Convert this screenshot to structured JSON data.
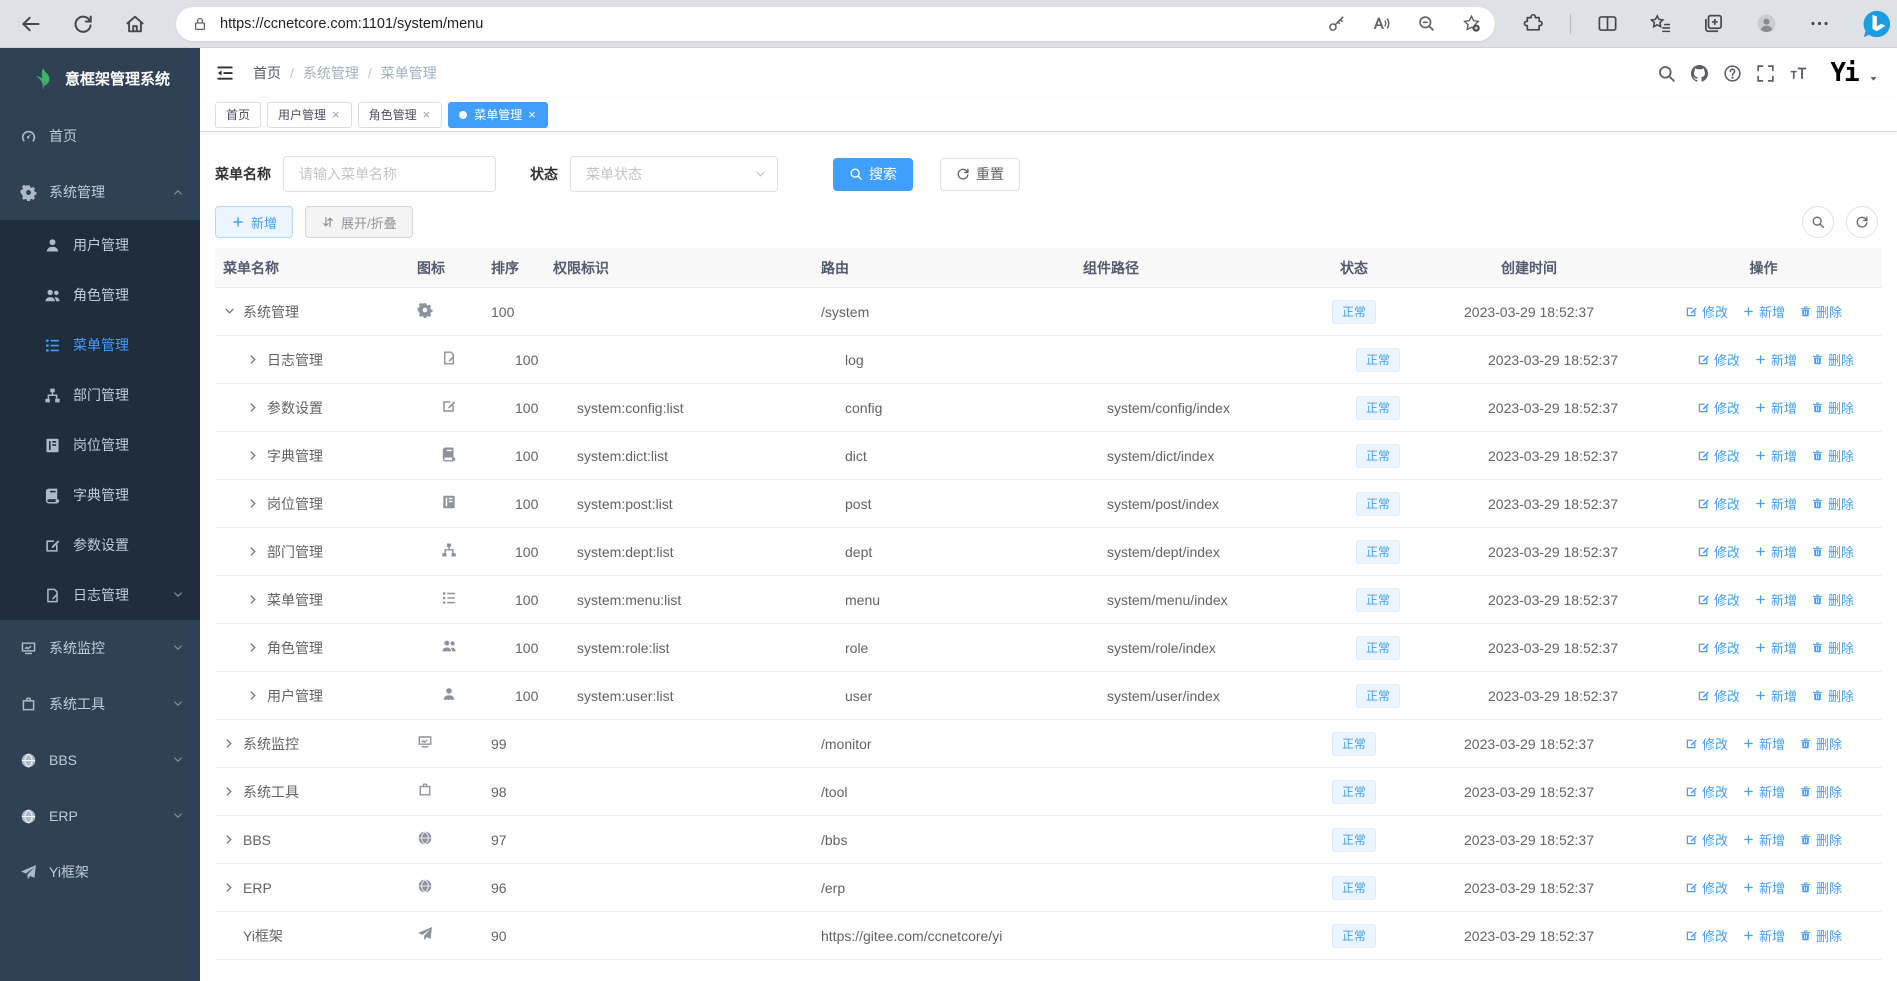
{
  "browser": {
    "url": "https://ccnetcore.com:1101/system/menu",
    "nav_icons": [
      "back-icon",
      "refresh-icon",
      "home-icon"
    ],
    "address_left_icon": "lock-icon",
    "address_right_icons": [
      "key-icon",
      "read-aloud-icon",
      "zoom-out-icon",
      "favorite-add-icon"
    ],
    "toolbar_icons": [
      "extensions-icon",
      "split-screen-icon",
      "favorites-bar-icon",
      "collections-icon",
      "profile-icon",
      "more-icon"
    ],
    "bing_icon": "bing-icon"
  },
  "sidebar": {
    "title": "意框架管理系统",
    "logo_icon": "leaf-icon",
    "items": [
      {
        "key": "home",
        "label": "首页",
        "icon": "dashboard-icon"
      },
      {
        "key": "system",
        "label": "系统管理",
        "icon": "gear-icon",
        "expanded": true,
        "children": [
          {
            "key": "user",
            "label": "用户管理",
            "icon": "user-icon"
          },
          {
            "key": "role",
            "label": "角色管理",
            "icon": "peoples-icon"
          },
          {
            "key": "menu",
            "label": "菜单管理",
            "icon": "menu-tree-icon",
            "active": true
          },
          {
            "key": "dept",
            "label": "部门管理",
            "icon": "dept-tree-icon"
          },
          {
            "key": "post",
            "label": "岗位管理",
            "icon": "post-icon"
          },
          {
            "key": "dict",
            "label": "字典管理",
            "icon": "dict-icon"
          },
          {
            "key": "config",
            "label": "参数设置",
            "icon": "edit-icon"
          },
          {
            "key": "log",
            "label": "日志管理",
            "icon": "log-icon",
            "collapsible": true
          }
        ]
      },
      {
        "key": "monitor",
        "label": "系统监控",
        "icon": "monitor-icon",
        "collapsible": true
      },
      {
        "key": "tool",
        "label": "系统工具",
        "icon": "tool-icon",
        "collapsible": true
      },
      {
        "key": "bbs",
        "label": "BBS",
        "icon": "globe-icon",
        "collapsible": true
      },
      {
        "key": "erp",
        "label": "ERP",
        "icon": "globe-icon",
        "collapsible": true
      },
      {
        "key": "yi",
        "label": "Yi框架",
        "icon": "plane-icon"
      }
    ]
  },
  "header": {
    "fold_icon": "fold-icon",
    "breadcrumb": [
      "首页",
      "系统管理",
      "菜单管理"
    ],
    "icons": [
      "search-icon",
      "github-icon",
      "question-icon",
      "fullscreen-icon",
      "font-size-icon"
    ],
    "logo_text": "Yi",
    "caret_icon": "caret-down-icon"
  },
  "tabs": [
    {
      "key": "home",
      "label": "首页",
      "closable": false,
      "active": false
    },
    {
      "key": "user",
      "label": "用户管理",
      "closable": true,
      "active": false
    },
    {
      "key": "role",
      "label": "角色管理",
      "closable": true,
      "active": false
    },
    {
      "key": "menu",
      "label": "菜单管理",
      "closable": true,
      "active": true
    }
  ],
  "filters": {
    "name_label": "菜单名称",
    "name_placeholder": "请输入菜单名称",
    "name_value": "",
    "status_label": "状态",
    "status_placeholder": "菜单状态",
    "search_label": "搜索",
    "reset_label": "重置"
  },
  "toolbar": {
    "add_label": "新增",
    "expand_label": "展开/折叠",
    "icon_buttons": [
      "search-icon",
      "refresh-icon"
    ]
  },
  "table": {
    "columns": [
      {
        "key": "name",
        "label": "菜单名称"
      },
      {
        "key": "icon",
        "label": "图标"
      },
      {
        "key": "sort",
        "label": "排序"
      },
      {
        "key": "perm",
        "label": "权限标识"
      },
      {
        "key": "route",
        "label": "路由"
      },
      {
        "key": "comp",
        "label": "组件路径"
      },
      {
        "key": "status",
        "label": "状态"
      },
      {
        "key": "time",
        "label": "创建时间"
      },
      {
        "key": "ops",
        "label": "操作"
      }
    ],
    "op_actions": [
      {
        "label": "修改",
        "icon": "edit-icon"
      },
      {
        "label": "新增",
        "icon": "plus-icon"
      },
      {
        "label": "删除",
        "icon": "delete-icon"
      }
    ],
    "rows": [
      {
        "name": "系统管理",
        "icon": "gear-icon",
        "expand": "open",
        "level": 0,
        "sort": "100",
        "perm": "",
        "route": "/system",
        "comp": "",
        "status": "正常",
        "time": "2023-03-29 18:52:37"
      },
      {
        "name": "日志管理",
        "icon": "log-icon",
        "expand": "closed",
        "level": 1,
        "sort": "100",
        "perm": "",
        "route": "log",
        "comp": "",
        "status": "正常",
        "time": "2023-03-29 18:52:37"
      },
      {
        "name": "参数设置",
        "icon": "edit-icon",
        "expand": "closed",
        "level": 1,
        "sort": "100",
        "perm": "system:config:list",
        "route": "config",
        "comp": "system/config/index",
        "status": "正常",
        "time": "2023-03-29 18:52:37"
      },
      {
        "name": "字典管理",
        "icon": "dict-icon",
        "expand": "closed",
        "level": 1,
        "sort": "100",
        "perm": "system:dict:list",
        "route": "dict",
        "comp": "system/dict/index",
        "status": "正常",
        "time": "2023-03-29 18:52:37"
      },
      {
        "name": "岗位管理",
        "icon": "post-icon",
        "expand": "closed",
        "level": 1,
        "sort": "100",
        "perm": "system:post:list",
        "route": "post",
        "comp": "system/post/index",
        "status": "正常",
        "time": "2023-03-29 18:52:37"
      },
      {
        "name": "部门管理",
        "icon": "dept-tree-icon",
        "expand": "closed",
        "level": 1,
        "sort": "100",
        "perm": "system:dept:list",
        "route": "dept",
        "comp": "system/dept/index",
        "status": "正常",
        "time": "2023-03-29 18:52:37"
      },
      {
        "name": "菜单管理",
        "icon": "menu-tree-icon",
        "expand": "closed",
        "level": 1,
        "sort": "100",
        "perm": "system:menu:list",
        "route": "menu",
        "comp": "system/menu/index",
        "status": "正常",
        "time": "2023-03-29 18:52:37"
      },
      {
        "name": "角色管理",
        "icon": "peoples-icon",
        "expand": "closed",
        "level": 1,
        "sort": "100",
        "perm": "system:role:list",
        "route": "role",
        "comp": "system/role/index",
        "status": "正常",
        "time": "2023-03-29 18:52:37"
      },
      {
        "name": "用户管理",
        "icon": "user-icon",
        "expand": "closed",
        "level": 1,
        "sort": "100",
        "perm": "system:user:list",
        "route": "user",
        "comp": "system/user/index",
        "status": "正常",
        "time": "2023-03-29 18:52:37"
      },
      {
        "name": "系统监控",
        "icon": "monitor-icon",
        "expand": "closed",
        "level": 0,
        "sort": "99",
        "perm": "",
        "route": "/monitor",
        "comp": "",
        "status": "正常",
        "time": "2023-03-29 18:52:37"
      },
      {
        "name": "系统工具",
        "icon": "tool-icon",
        "expand": "closed",
        "level": 0,
        "sort": "98",
        "perm": "",
        "route": "/tool",
        "comp": "",
        "status": "正常",
        "time": "2023-03-29 18:52:37"
      },
      {
        "name": "BBS",
        "icon": "globe-icon",
        "expand": "closed",
        "level": 0,
        "sort": "97",
        "perm": "",
        "route": "/bbs",
        "comp": "",
        "status": "正常",
        "time": "2023-03-29 18:52:37"
      },
      {
        "name": "ERP",
        "icon": "globe-icon",
        "expand": "closed",
        "level": 0,
        "sort": "96",
        "perm": "",
        "route": "/erp",
        "comp": "",
        "status": "正常",
        "time": "2023-03-29 18:52:37"
      },
      {
        "name": "Yi框架",
        "icon": "plane-icon",
        "expand": "none",
        "level": 0,
        "sort": "90",
        "perm": "",
        "route": "https://gitee.com/ccnetcore/yi",
        "comp": "",
        "status": "正常",
        "time": "2023-03-29 18:52:37"
      }
    ]
  },
  "colors": {
    "accent": "#409eff",
    "sidebar_bg": "#304156",
    "sidebar_sub_bg": "#1f2d3d",
    "logo_green": "#3eb370",
    "active_tab_bg": "#409eff",
    "status_tag_bg": "#ecf5ff",
    "status_tag_border": "#d9ecff",
    "status_tag_text": "#409eff"
  }
}
